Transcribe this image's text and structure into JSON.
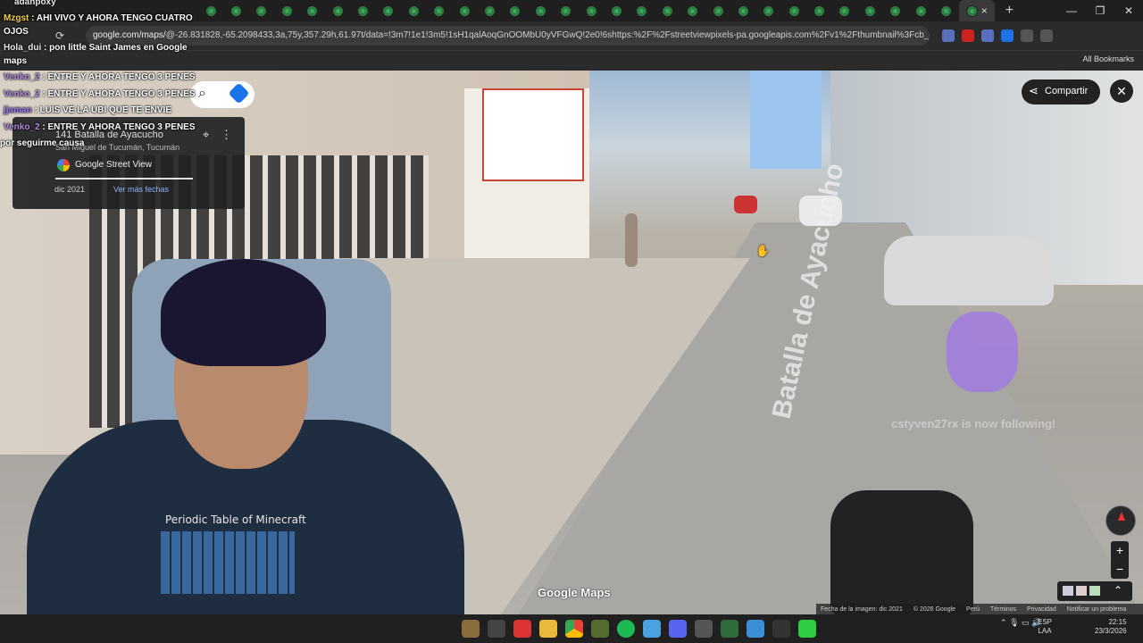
{
  "browser": {
    "url_host": "google.com/maps/",
    "url_rest": "@-26.831828,-65.2098433,3a,75y,357.29h,61.97t/data=!3m7!1e1!3m5!1sH1qalAoqGnOOMbU0yVFGwQ!2e0!6shttps:%2F%2Fstreetviewpixels-pa.googleapis.com%2Fv1%2Fthumbnail%3Fcb_cl...",
    "all_bookmarks": "All Bookmarks",
    "tab_close": "×",
    "new_tab": "+",
    "window": {
      "minimize": "—",
      "maximize": "❐",
      "close": "✕"
    }
  },
  "streetview": {
    "address": "141 Batalla de Ayacucho",
    "city": "San Miguel de Tucumán, Tucumán",
    "source": "Google Street View",
    "date": "dic 2021",
    "more_dates": "Ver más fechas",
    "share": "Compartir",
    "street_label": "Batalla de Ayacucho",
    "follow_text": "cstyven27rx is now following!",
    "logo": "Google Maps",
    "footer": {
      "image_date": "Fecha de la imagen: dic 2021",
      "copyright": "© 2026 Google",
      "country": "Perú",
      "terms": "Términos",
      "privacy": "Privacidad",
      "report": "Notificar un problema"
    },
    "zoom_in": "+",
    "zoom_out": "−"
  },
  "chat": [
    {
      "user": "adanpoxy",
      "message": ""
    },
    {
      "user": "Mzgst",
      "message": "AHI VIVO Y AHORA TENGO CUATRO"
    },
    {
      "user": "",
      "message": "OJOS"
    },
    {
      "user": "Hola_dui",
      "message": "pon little Saint James en Google"
    },
    {
      "user": "",
      "message": "maps"
    },
    {
      "user": "Venko_2",
      "message": "ENTRE Y AHORA TENGO 3 PENES"
    },
    {
      "user": "Venko_2",
      "message": "ENTRE Y AHORA TENGO 3 PENES"
    },
    {
      "user": "jjaman",
      "message": "LUIS VE LA UBI QUE TE ENVIE"
    },
    {
      "user": "Venko_2",
      "message": "ENTRE Y AHORA TENGO 3 PENES"
    },
    {
      "user": "",
      "message": "por seguirme causa"
    }
  ],
  "webcam": {
    "shirt_text": "Periodic Table of Minecraft"
  },
  "taskbar": {
    "lang_1": "ESP",
    "lang_2": "LAA",
    "time": "22:15",
    "date": "23/3/2026"
  },
  "colors": {
    "accent": "#1a73e8",
    "chat_yellow": "#f2d04c",
    "chat_purple": "#b08ce0"
  }
}
